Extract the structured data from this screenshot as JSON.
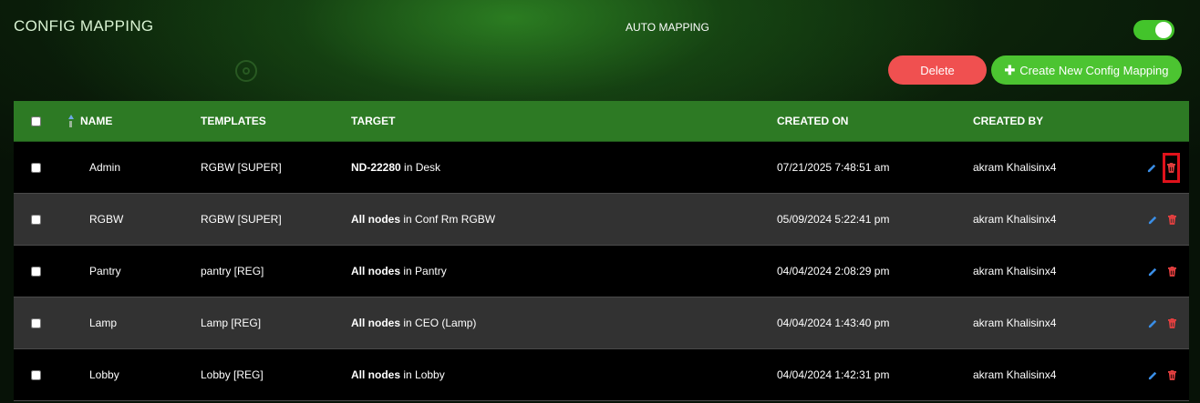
{
  "header": {
    "title": "CONFIG MAPPING",
    "auto_mapping_label": "AUTO MAPPING",
    "auto_mapping_enabled": true
  },
  "toolbar": {
    "delete_label": "Delete",
    "create_label": "Create New Config Mapping"
  },
  "table": {
    "columns": {
      "name": "NAME",
      "templates": "TEMPLATES",
      "target": "TARGET",
      "created_on": "CREATED ON",
      "created_by": "CREATED BY"
    },
    "rows": [
      {
        "name": "Admin",
        "template": "RGBW [SUPER]",
        "target_main": "ND-22280",
        "target_rest": " in Desk",
        "created_on": "07/21/2025 7:48:51 am",
        "created_by": "akram Khalisinx4"
      },
      {
        "name": "RGBW",
        "template": "RGBW [SUPER]",
        "target_main": "All nodes",
        "target_rest": " in Conf Rm RGBW",
        "created_on": "05/09/2024 5:22:41 pm",
        "created_by": "akram Khalisinx4"
      },
      {
        "name": "Pantry",
        "template": "pantry [REG]",
        "target_main": "All nodes",
        "target_rest": " in Pantry",
        "created_on": "04/04/2024 2:08:29 pm",
        "created_by": "akram Khalisinx4"
      },
      {
        "name": "Lamp",
        "template": "Lamp [REG]",
        "target_main": "All nodes",
        "target_rest": " in CEO (Lamp)",
        "created_on": "04/04/2024 1:43:40 pm",
        "created_by": "akram Khalisinx4"
      },
      {
        "name": "Lobby",
        "template": "Lobby [REG]",
        "target_main": "All nodes",
        "target_rest": " in Lobby",
        "created_on": "04/04/2024 1:42:31 pm",
        "created_by": "akram Khalisinx4"
      }
    ]
  },
  "colors": {
    "accent_green": "#4cc431",
    "header_green": "#2d7a24",
    "delete_red": "#f05050",
    "edit_blue": "#3a8ee6",
    "trash_red": "#e84040",
    "highlight_red": "#e0121b"
  },
  "icons": {
    "edit": "pencil-icon",
    "delete": "trash-icon",
    "create": "plus-icon",
    "sort": "sort-ascending-icon"
  }
}
